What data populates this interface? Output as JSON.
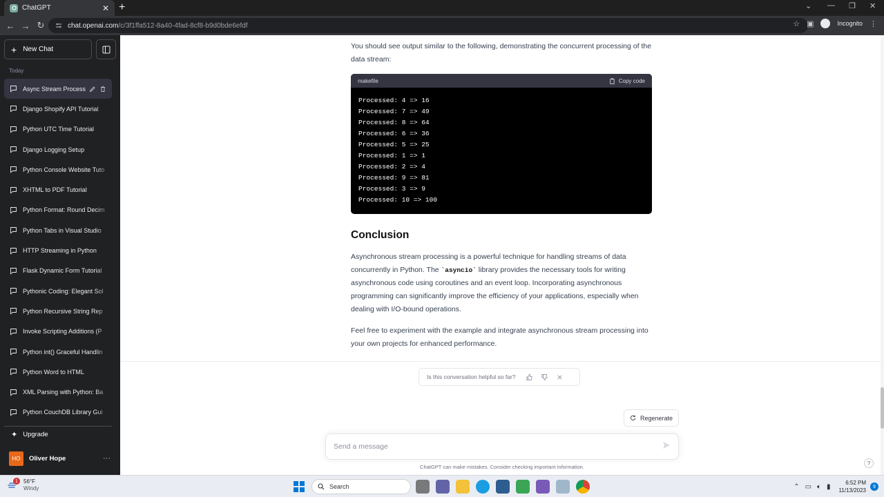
{
  "browser": {
    "tab_title": "ChatGPT",
    "new_tab": "+",
    "url_host": "chat.openai.com",
    "url_path": "/c/3f1ffa512-8a40-4fad-8cf8-b9d0bde6efdf",
    "incognito_label": "Incognito"
  },
  "sidebar": {
    "new_chat_label": "New Chat",
    "section_label": "Today",
    "items": [
      {
        "label": "Async Stream Process"
      },
      {
        "label": "Django Shopify API Tutorial"
      },
      {
        "label": "Python UTC Time Tutorial"
      },
      {
        "label": "Django Logging Setup"
      },
      {
        "label": "Python Console Website Tuto"
      },
      {
        "label": "XHTML to PDF Tutorial"
      },
      {
        "label": "Python Format: Round Decim"
      },
      {
        "label": "Python Tabs in Visual Studio"
      },
      {
        "label": "HTTP Streaming in Python"
      },
      {
        "label": "Flask Dynamic Form Tutorial"
      },
      {
        "label": "Pythonic Coding: Elegant Sol"
      },
      {
        "label": "Python Recursive String Rep"
      },
      {
        "label": "Invoke Scripting Additions (P"
      },
      {
        "label": "Python int() Graceful Handlin"
      },
      {
        "label": "Python Word to HTML"
      },
      {
        "label": "XML Parsing with Python: Ba"
      },
      {
        "label": "Python CouchDB Library Gui"
      }
    ],
    "upgrade_label": "Upgrade",
    "user_initials": "HO",
    "user_name": "Oliver Hope",
    "more": "···"
  },
  "main": {
    "intro": "You should see output similar to the following, demonstrating the concurrent processing of the data stream:",
    "code_lang": "makefile",
    "copy_label": "Copy code",
    "code": "Processed: 4 => 16\nProcessed: 7 => 49\nProcessed: 8 => 64\nProcessed: 6 => 36\nProcessed: 5 => 25\nProcessed: 1 => 1\nProcessed: 2 => 4\nProcessed: 9 => 81\nProcessed: 3 => 9\nProcessed: 10 => 100",
    "heading": "Conclusion",
    "para1_a": "Asynchronous stream processing is a powerful technique for handling streams of data concurrently in Python. The ",
    "para1_code": "`asyncio`",
    "para1_b": " library provides the necessary tools for writing asynchronous code using coroutines and an event loop. Incorporating asynchronous programming can significantly improve the efficiency of your applications, especially when dealing with I/O-bound operations.",
    "para2": "Feel free to experiment with the example and integrate asynchronous stream processing into your own projects for enhanced performance."
  },
  "bottom": {
    "feedback_question": "Is this conversation helpful so far?",
    "regenerate_label": "Regenerate",
    "composer_placeholder": "Send a message",
    "disclaimer": "ChatGPT can make mistakes. Consider checking important information.",
    "help": "?"
  },
  "taskbar": {
    "weather_temp": "56°F",
    "weather_desc": "Windy",
    "weather_badge": "1",
    "search_label": "Search",
    "time": "6:52 PM",
    "date": "11/13/2023",
    "notif_count": "9"
  },
  "colors": {
    "sidebar_bg": "#202123",
    "accent_avatar": "#e8681a",
    "code_bg": "#000000"
  }
}
